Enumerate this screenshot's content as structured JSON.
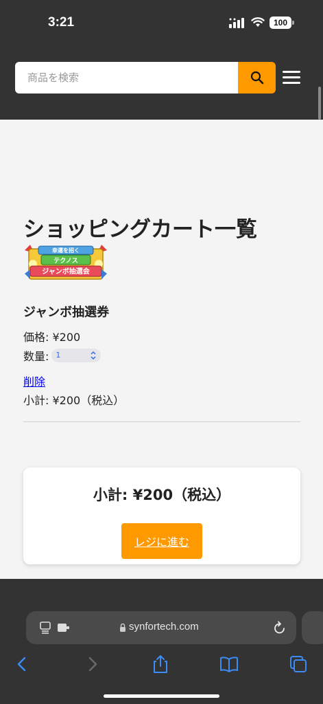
{
  "status_bar": {
    "time": "3:21",
    "battery": "100",
    "icons": [
      "signal-icon",
      "wifi-icon",
      "battery-icon"
    ]
  },
  "header": {
    "search_placeholder": "商品を検索",
    "search_icon": "search-icon",
    "menu_icon": "hamburger-menu-icon"
  },
  "cart": {
    "title": "ショッピングカート一覧",
    "item": {
      "name": "ジャンボ抽選券",
      "price_label": "価格: ¥200",
      "quantity_label": "数量:",
      "quantity_value": "1",
      "delete_label": "削除",
      "subtotal_label": "小計: ¥200（税込）",
      "image_text": [
        "幸運を招く",
        "テクノス",
        "ジャンボ抽選会"
      ]
    },
    "summary": {
      "total_label": "小計: ¥200（税込）",
      "checkout_label": "レジに進む"
    }
  },
  "browser": {
    "url": "synfortech.com",
    "icons": [
      "reader-icon",
      "extension-icon",
      "lock-icon",
      "reload-icon",
      "back-icon",
      "forward-icon",
      "share-icon",
      "bookmarks-icon",
      "tabs-icon"
    ]
  },
  "colors": {
    "dark": "#333333",
    "accent": "#ff9900",
    "link": "#0000ee",
    "background": "#f4f4f4"
  }
}
